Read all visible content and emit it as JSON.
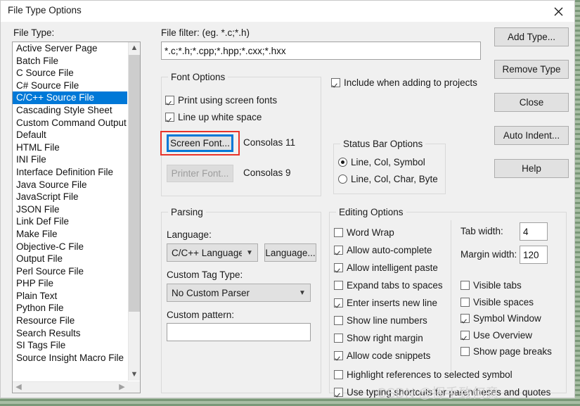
{
  "window": {
    "title": "File Type Options",
    "close_icon": "close-icon"
  },
  "file_type": {
    "label": "File Type:",
    "selected": "C/C++ Source File",
    "items": [
      "Active Server Page",
      "Batch File",
      "C Source File",
      "C# Source File",
      "C/C++ Source File",
      "Cascading Style Sheet",
      "Custom Command Output",
      "Default",
      "HTML File",
      "INI File",
      "Interface Definition File",
      "Java Source File",
      "JavaScript File",
      "JSON File",
      "Link Def File",
      "Make File",
      "Objective-C File",
      "Output File",
      "Perl Source File",
      "PHP File",
      "Plain Text",
      "Python File",
      "Resource File",
      "Search Results",
      "SI Tags File",
      "Source Insight Macro File"
    ],
    "scroll_up_icon": "chevron-up-icon",
    "scroll_down_icon": "chevron-down-icon",
    "scroll_left_icon": "chevron-left-icon",
    "scroll_right_icon": "chevron-right-icon"
  },
  "file_filter": {
    "label": "File filter: (eg. *.c;*.h)",
    "value": "*.c;*.h;*.cpp;*.hpp;*.cxx;*.hxx",
    "placeholder": "*.c;*.h"
  },
  "font_options": {
    "title": "Font Options",
    "print_using_screen_fonts": {
      "label": "Print using screen fonts",
      "checked": true
    },
    "line_up_white_space": {
      "label": "Line up white space",
      "checked": true
    },
    "screen_font_button": "Screen Font...",
    "screen_font_value": "Consolas 11",
    "printer_font_button": "Printer Font...",
    "printer_font_value": "Consolas 9"
  },
  "include_when_adding": {
    "label": "Include when adding to projects",
    "checked": true
  },
  "status_bar_options": {
    "title": "Status Bar Options",
    "options": [
      {
        "label": "Line, Col, Symbol",
        "selected": true
      },
      {
        "label": "Line, Col, Char, Byte",
        "selected": false
      }
    ]
  },
  "parsing": {
    "title": "Parsing",
    "language_label": "Language:",
    "language_value": "C/C++ Language",
    "language_button": "Language...",
    "custom_tag_type_label": "Custom Tag Type:",
    "custom_tag_type_value": "No Custom Parser",
    "custom_pattern_label": "Custom pattern:",
    "custom_pattern_value": "",
    "dropdown_icon": "chevron-down-icon"
  },
  "editing_options": {
    "title": "Editing Options",
    "left_column": [
      {
        "label": "Word Wrap",
        "checked": false
      },
      {
        "label": "Allow auto-complete",
        "checked": true
      },
      {
        "label": "Allow intelligent paste",
        "checked": true
      },
      {
        "label": "Expand tabs to spaces",
        "checked": false
      },
      {
        "label": "Enter inserts new line",
        "checked": true
      },
      {
        "label": "Show line numbers",
        "checked": false
      },
      {
        "label": "Show right margin",
        "checked": false
      },
      {
        "label": "Allow code snippets",
        "checked": true
      }
    ],
    "right_column": [
      {
        "label": "Visible tabs",
        "checked": false
      },
      {
        "label": "Visible spaces",
        "checked": false
      },
      {
        "label": "Symbol Window",
        "checked": true
      },
      {
        "label": "Use Overview",
        "checked": true
      },
      {
        "label": "Show page breaks",
        "checked": false
      }
    ],
    "bottom_rows": [
      {
        "label": "Highlight references to selected symbol",
        "checked": false
      },
      {
        "label": "Use typing shortcuts for parentheses and quotes",
        "checked": true
      }
    ],
    "tab_width_label": "Tab width:",
    "tab_width_value": "4",
    "margin_width_label": "Margin width:",
    "margin_width_value": "120"
  },
  "side_buttons": [
    "Add Type...",
    "Remove Type",
    "Close",
    "Auto Indent...",
    "Help"
  ],
  "watermark": "CSDN @挥手致何意",
  "colors": {
    "selection_blue": "#0078d7",
    "focus_blue": "#0078d7",
    "annotation_red": "#e8332a",
    "dialog_bg": "#f0f0f0",
    "button_bg": "#e1e1e1"
  }
}
